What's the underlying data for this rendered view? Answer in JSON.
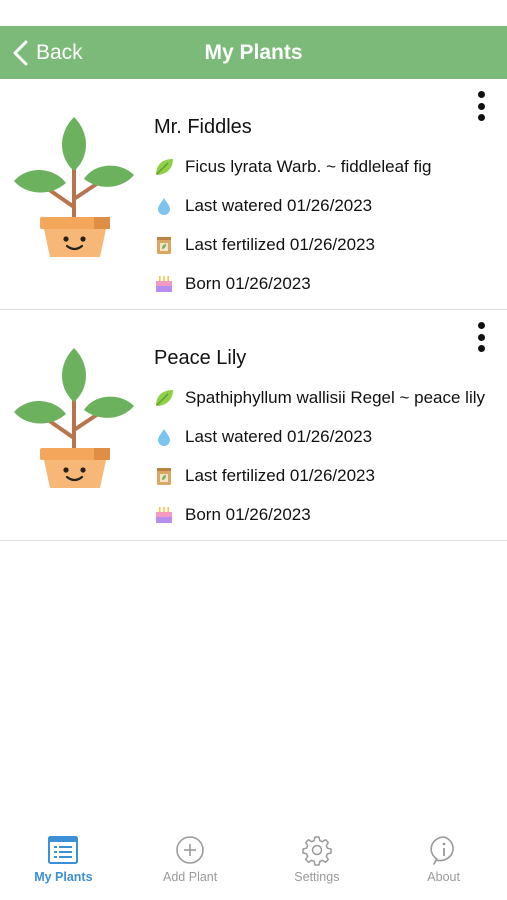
{
  "nav": {
    "back_label": "Back",
    "title": "My Plants"
  },
  "plants": [
    {
      "name": "Mr. Fiddles",
      "species": "Ficus lyrata Warb. ~ fiddleleaf fig",
      "watered": "Last watered 01/26/2023",
      "fertilized": "Last fertilized 01/26/2023",
      "born": "Born 01/26/2023"
    },
    {
      "name": "Peace Lily",
      "species": "Spathiphyllum wallisii Regel ~ peace lily",
      "watered": "Last watered 01/26/2023",
      "fertilized": "Last fertilized 01/26/2023",
      "born": "Born 01/26/2023"
    }
  ],
  "icons": {
    "species": "leaf-icon",
    "watered": "water-drop-icon",
    "fertilized": "fertilizer-bag-icon",
    "born": "birthday-cake-icon",
    "more": "more-vertical-icon"
  },
  "tabs": [
    {
      "label": "My Plants",
      "icon": "list-icon",
      "active": true
    },
    {
      "label": "Add Plant",
      "icon": "add-circle-icon",
      "active": false
    },
    {
      "label": "Settings",
      "icon": "gear-icon",
      "active": false
    },
    {
      "label": "About",
      "icon": "info-icon",
      "active": false
    }
  ],
  "colors": {
    "header": "#7bba78",
    "active_tab": "#3d8fd6",
    "inactive_tab": "#9a9a9a",
    "leaf": "#6cb25e",
    "pot": "#f4b06a"
  }
}
